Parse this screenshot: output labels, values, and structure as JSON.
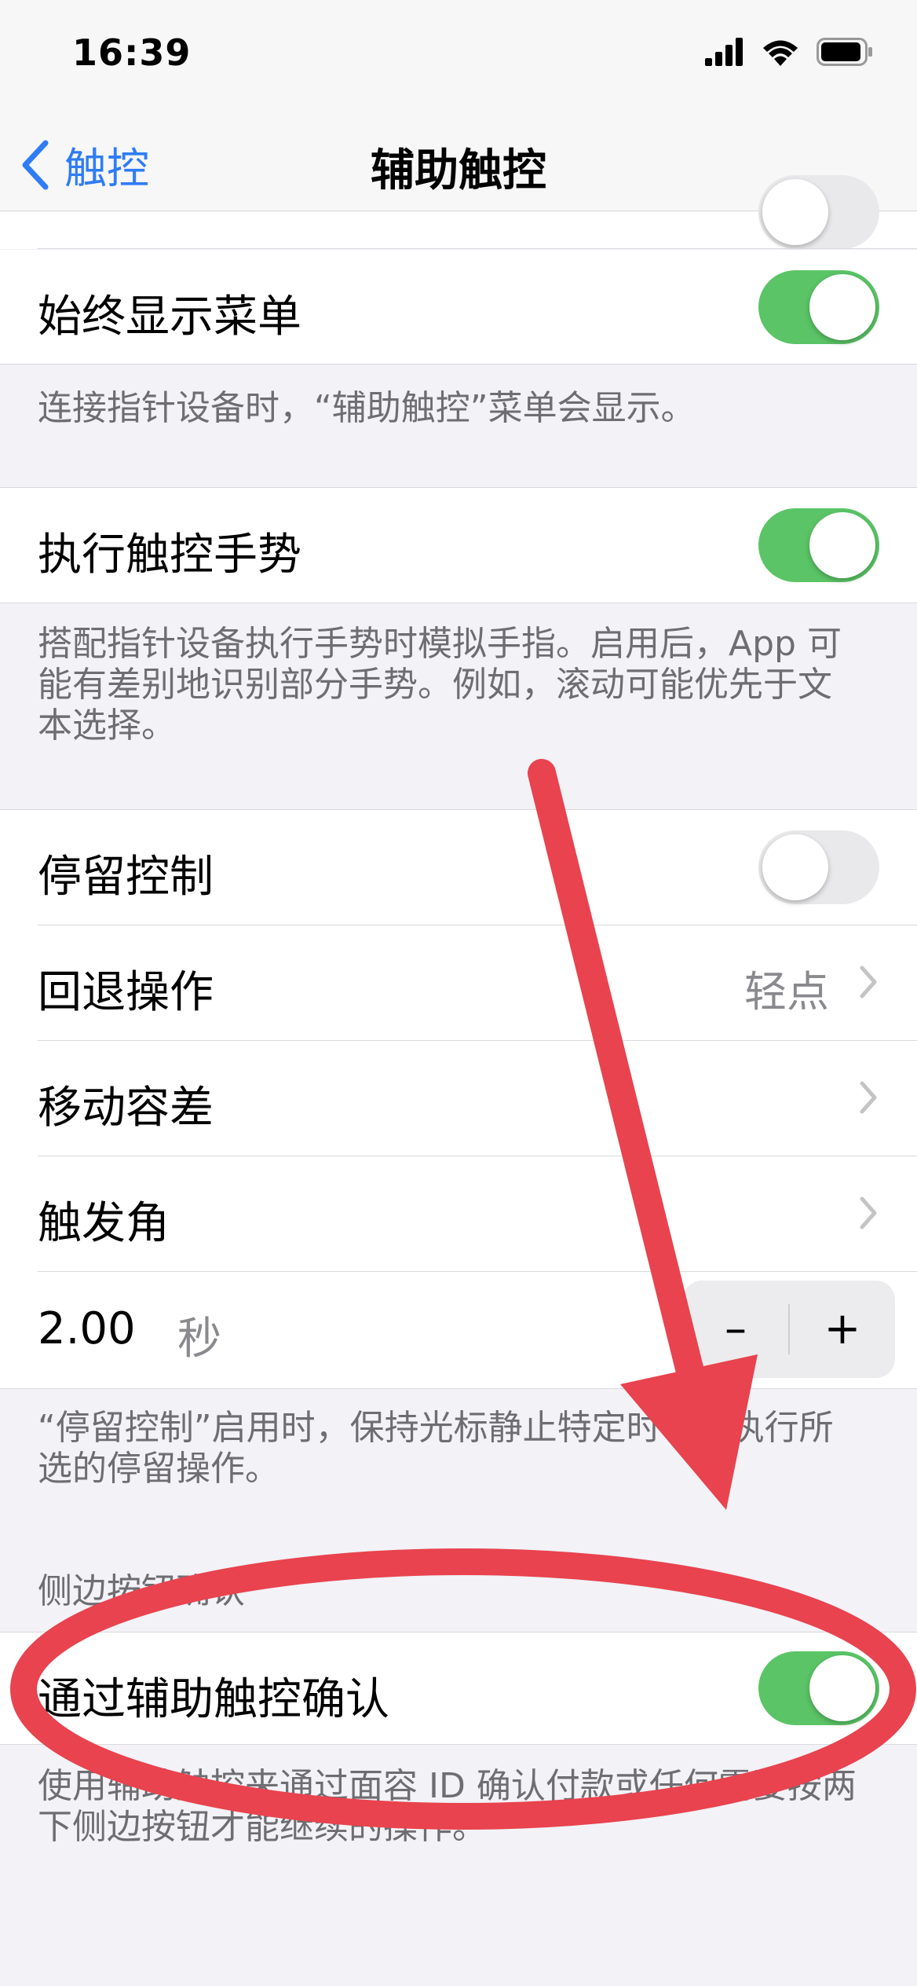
{
  "status": {
    "time": "16:39"
  },
  "nav": {
    "back_label": "触控",
    "title": "辅助触控"
  },
  "sections": {
    "always_show_menu": {
      "label": "始终显示菜单",
      "on": true,
      "footer": "连接指针设备时，“辅助触控”菜单会显示。"
    },
    "perform_gestures": {
      "label": "执行触控手势",
      "on": true,
      "footer_line1": "搭配指针设备执行手势时模拟手指。启用后，App 可",
      "footer_line2": "能有差别地识别部分手势。例如，滚动可能优先于文",
      "footer_line3": "本选择。"
    },
    "dwell": {
      "dwell_label": "停留控制",
      "dwell_on": false,
      "fallback_label": "回退操作",
      "fallback_value": "轻点",
      "tolerance_label": "移动容差",
      "hot_corners_label": "触发角",
      "time_value": "2.00",
      "time_unit": "秒",
      "minus": "–",
      "plus": "+",
      "footer_line1": "“停留控制”启用时，保持光标静止特定时长将执行所",
      "footer_line2": "选的停留操作。"
    },
    "side_button": {
      "header": "侧边按钮确认",
      "label": "通过辅助触控确认",
      "on": true,
      "footer_line1": "使用辅助触控来通过面容 ID 确认付款或任何需要按两",
      "footer_line2": "下侧边按钮才能继续的操作。"
    }
  },
  "colors": {
    "accent": "#2f7cf6",
    "toggle_on": "#5ac466",
    "annotation": "#e8434e"
  }
}
